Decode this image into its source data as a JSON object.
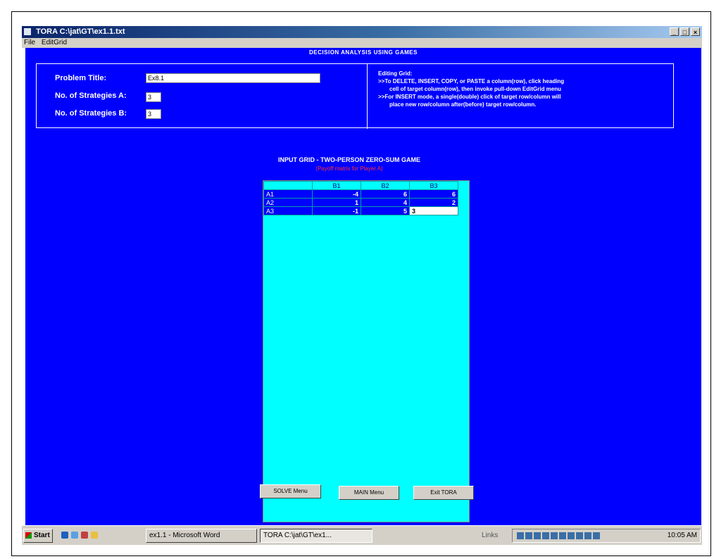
{
  "window": {
    "title": "TORA C:\\jat\\GT\\ex1.1.txt",
    "controls": [
      "_",
      "□",
      "×"
    ]
  },
  "menu": [
    "File",
    "EditGrid"
  ],
  "header": {
    "section_title": "DECISION ANALYSIS USING GAMES"
  },
  "form": {
    "problem_title_label": "Problem Title:",
    "problem_title_value": "Ex8.1",
    "strategies_a_label": "No. of Strategies A:",
    "strategies_a_value": "3",
    "strategies_b_label": "No. of Strategies B:",
    "strategies_b_value": "3"
  },
  "help": {
    "heading": "Editing Grid:",
    "line1": ">>To DELETE, INSERT, COPY, or PASTE a column(row), click heading",
    "line2": "cell of target column(row), then invoke pull-down EditGrid menu",
    "line3": ">>For INSERT mode, a single(double) click of target row/column will",
    "line4": "place new row/column after(before) target row/column."
  },
  "grid": {
    "title": "INPUT GRID - TWO-PERSON ZERO-SUM GAME",
    "subtitle": "(Payoff matrix for Player A)",
    "columns": [
      "B1",
      "B2",
      "B3"
    ],
    "rows": [
      {
        "label": "A1",
        "values": [
          "-4",
          "6",
          "6"
        ]
      },
      {
        "label": "A2",
        "values": [
          "1",
          "4",
          "2"
        ]
      },
      {
        "label": "A3",
        "values": [
          "-1",
          "5",
          "3"
        ]
      }
    ]
  },
  "buttons": {
    "solve": "SOLVE Menu",
    "main": "MAIN Menu",
    "exit": "Exit TORA"
  },
  "taskbar": {
    "start": "Start",
    "task1": "ex1.1 - Microsoft Word",
    "task2": "TORA C:\\jat\\GT\\ex1...",
    "links": "Links",
    "clock": "10:05 AM"
  }
}
